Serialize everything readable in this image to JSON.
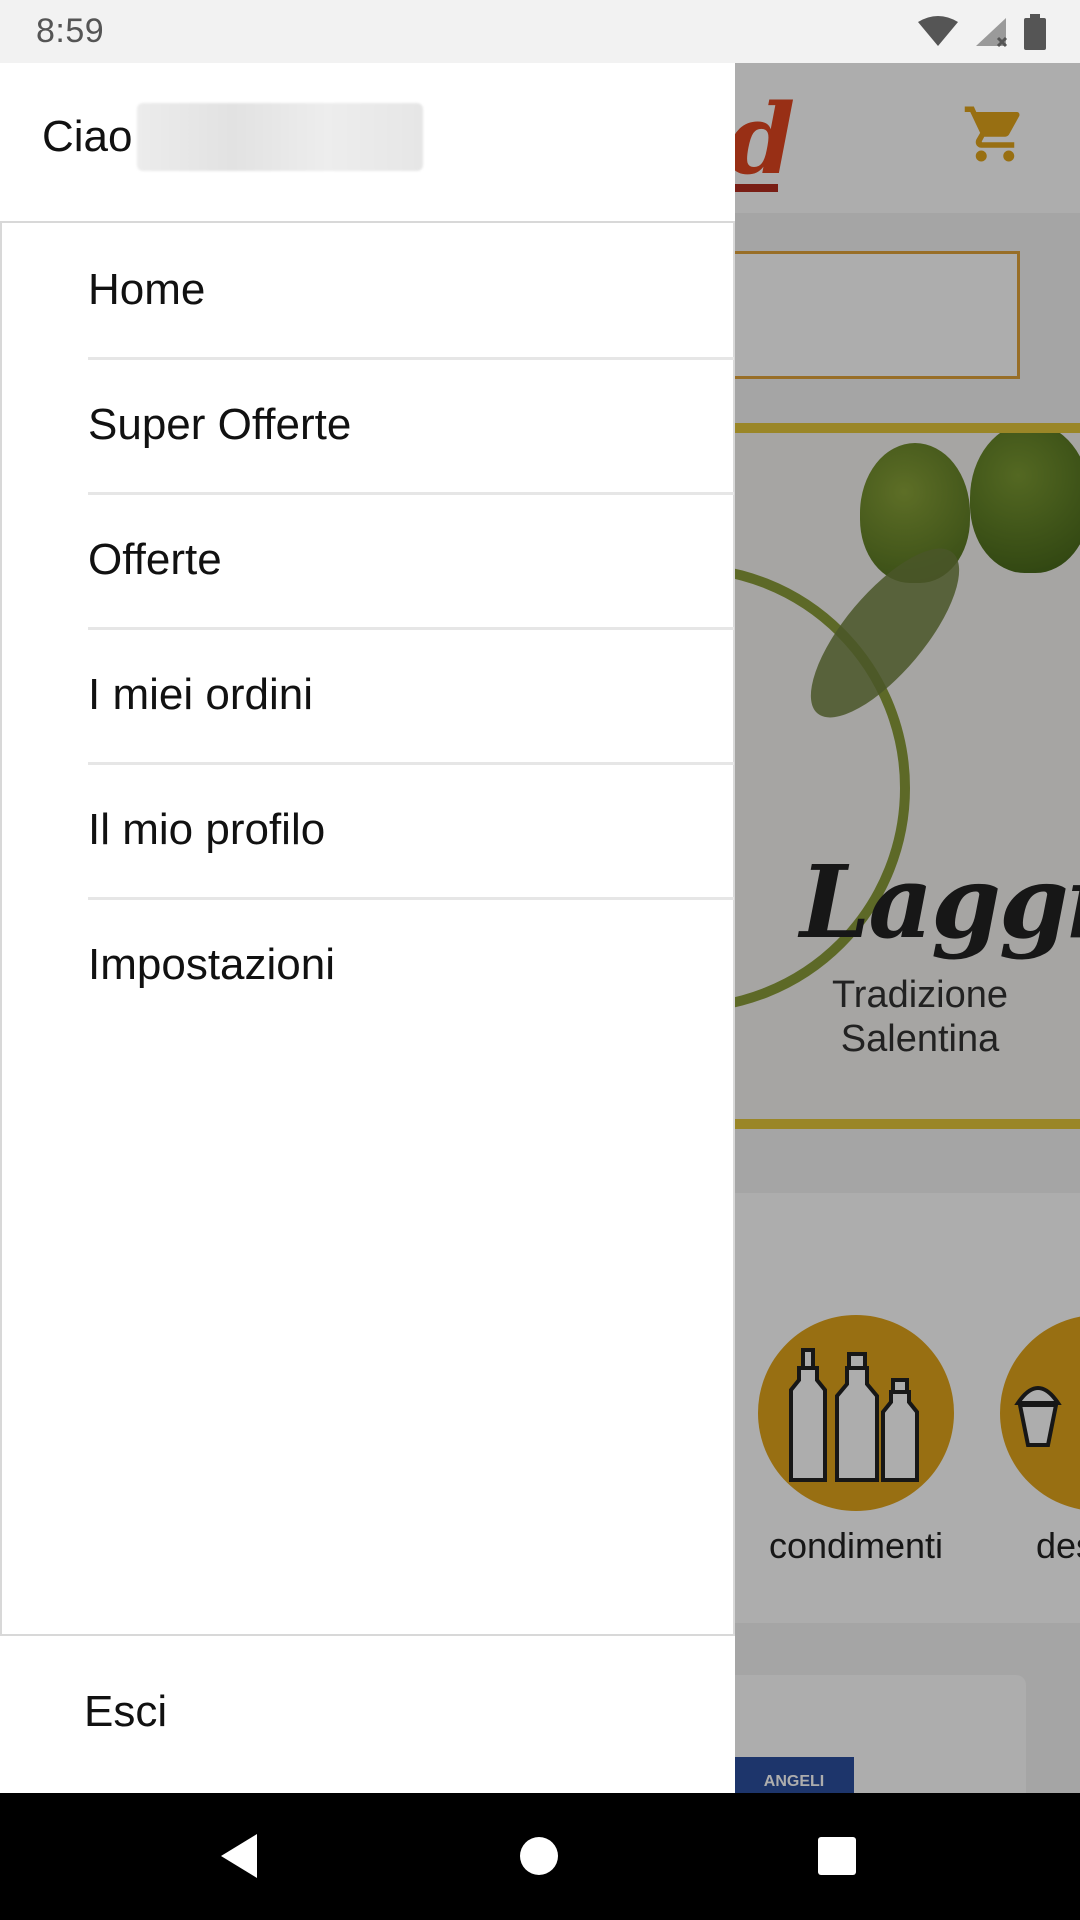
{
  "status_bar": {
    "time": "8:59"
  },
  "app": {
    "banner": {
      "brand": "Laggiù",
      "tagline_line1": "Tradizione",
      "tagline_line2": "Salentina"
    },
    "categories": [
      {
        "label": "condimenti"
      },
      {
        "label": "des"
      }
    ],
    "product_card": {
      "product_label": "ANGELI"
    }
  },
  "drawer": {
    "greeting": "Ciao",
    "menu": [
      {
        "label": "Home"
      },
      {
        "label": "Super Offerte"
      },
      {
        "label": "Offerte"
      },
      {
        "label": "I miei ordini"
      },
      {
        "label": "Il mio profilo"
      },
      {
        "label": "Impostazioni"
      }
    ],
    "logout": "Esci"
  },
  "colors": {
    "accent": "#e0a41b",
    "brand_red": "#e0461f",
    "olive": "#8a9b3a"
  }
}
